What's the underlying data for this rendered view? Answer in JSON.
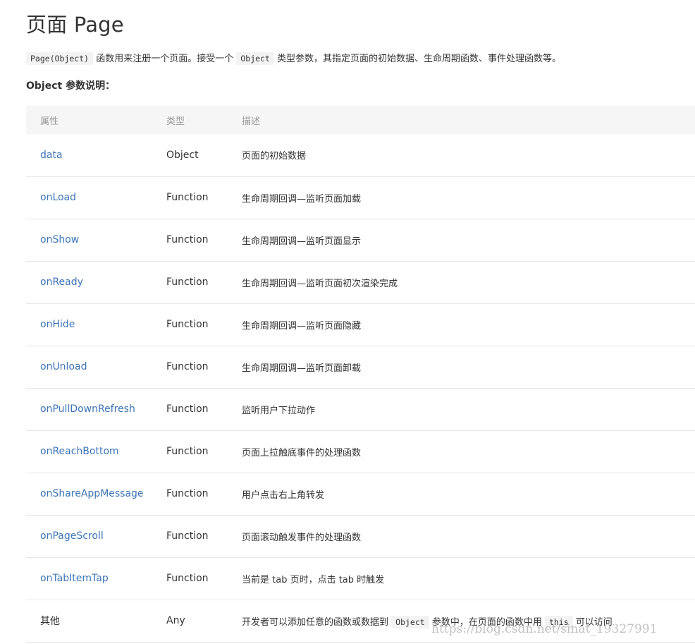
{
  "title": "页面 Page",
  "intro": {
    "code1": "Page(Object)",
    "text1": " 函数用来注册一个页面。接受一个 ",
    "code2": "Object",
    "text2": " 类型参数，其指定页面的初始数据、生命周期函数、事件处理函数等。"
  },
  "subtitle": "Object 参数说明：",
  "table": {
    "headers": [
      "属性",
      "类型",
      "描述"
    ],
    "rows": [
      {
        "name": "data",
        "type": "Object",
        "desc": "页面的初始数据"
      },
      {
        "name": "onLoad",
        "type": "Function",
        "desc": "生命周期回调—监听页面加载"
      },
      {
        "name": "onShow",
        "type": "Function",
        "desc": "生命周期回调—监听页面显示"
      },
      {
        "name": "onReady",
        "type": "Function",
        "desc": "生命周期回调—监听页面初次渲染完成"
      },
      {
        "name": "onHide",
        "type": "Function",
        "desc": "生命周期回调—监听页面隐藏"
      },
      {
        "name": "onUnload",
        "type": "Function",
        "desc": "生命周期回调—监听页面卸载"
      },
      {
        "name": "onPullDownRefresh",
        "type": "Function",
        "desc": "监听用户下拉动作"
      },
      {
        "name": "onReachBottom",
        "type": "Function",
        "desc": "页面上拉触底事件的处理函数"
      },
      {
        "name": "onShareAppMessage",
        "type": "Function",
        "desc": "用户点击右上角转发"
      },
      {
        "name": "onPageScroll",
        "type": "Function",
        "desc": "页面滚动触发事件的处理函数"
      },
      {
        "name": "onTabItemTap",
        "type": "Function",
        "desc": "当前是 tab 页时，点击 tab 时触发"
      }
    ],
    "last_row": {
      "name": "其他",
      "type": "Any",
      "desc_part1": "开发者可以添加任意的函数或数据到 ",
      "desc_code1": "Object",
      "desc_part2": " 参数中，在页面的函数中用 ",
      "desc_code2": "this",
      "desc_part3": " 可以访问"
    }
  },
  "watermark": "https://blog.csdn.net/sinat_19327991",
  "colors": {
    "link": "#3c74b6",
    "header_bg": "#f6f6f6",
    "header_text": "#999999",
    "border": "#e6e6e6"
  }
}
